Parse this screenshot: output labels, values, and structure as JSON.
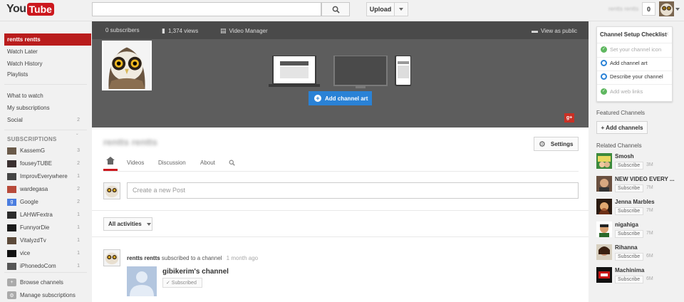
{
  "masthead": {
    "logo_you": "You",
    "logo_tube": "Tube",
    "upload_label": "Upload",
    "username": "rentts rentts",
    "notification_count": "0"
  },
  "guide": {
    "top_items": [
      {
        "label": "rentts rentts",
        "active": true
      },
      {
        "label": "Watch Later"
      },
      {
        "label": "Watch History"
      },
      {
        "label": "Playlists"
      }
    ],
    "mid_items": [
      {
        "label": "What to watch"
      },
      {
        "label": "My subscriptions"
      },
      {
        "label": "Social",
        "count": "2"
      }
    ],
    "subscriptions_heading": "SUBSCRIPTIONS",
    "subscriptions": [
      {
        "label": "KassemG",
        "count": "3"
      },
      {
        "label": "fouseyTUBE",
        "count": "2"
      },
      {
        "label": "ImprovEverywhere",
        "count": "1"
      },
      {
        "label": "wardegasa",
        "count": "2"
      },
      {
        "label": "Google",
        "count": "2"
      },
      {
        "label": "LAHWFextra",
        "count": "1"
      },
      {
        "label": "FunnyorDie",
        "count": "1"
      },
      {
        "label": "VitalyzdTv",
        "count": "1"
      },
      {
        "label": "vice",
        "count": "1"
      },
      {
        "label": "iPhonedoCom",
        "count": "1"
      }
    ],
    "browse_channels": "Browse channels",
    "manage_subscriptions": "Manage subscriptions"
  },
  "header": {
    "subscribers": "0 subscribers",
    "views": "1,374 views",
    "video_manager": "Video Manager",
    "view_as_public": "View as public",
    "add_channel_art": "Add channel art"
  },
  "channel": {
    "title": "rentts rentts",
    "settings_label": "Settings",
    "tabs": [
      "Videos",
      "Discussion",
      "About"
    ],
    "composer_placeholder": "Create a new Post",
    "activities_label": "All activities"
  },
  "feed": {
    "actor": "rentts rentts",
    "action": "subscribed to a channel",
    "ago": "1 month ago",
    "channel_name": "gibikerim's channel",
    "subscribed_label": "✓ Subscribed"
  },
  "right": {
    "checklist_title": "Channel Setup Checklist",
    "checklist": [
      {
        "label": "Set your channel icon",
        "done": true
      },
      {
        "label": "Add channel art",
        "done": false
      },
      {
        "label": "Describe your channel",
        "done": false
      },
      {
        "label": "Add web links",
        "done": true
      }
    ],
    "featured_heading": "Featured Channels",
    "add_channels_label": "+ Add channels",
    "related_heading": "Related Channels",
    "related": [
      {
        "name": "Smosh",
        "count": "3M"
      },
      {
        "name": "NEW VIDEO EVERY ...",
        "count": "7M"
      },
      {
        "name": "Jenna Marbles",
        "count": "7M"
      },
      {
        "name": "nigahiga",
        "count": "7M"
      },
      {
        "name": "Rihanna",
        "count": "6M"
      },
      {
        "name": "Machinima",
        "count": "6M"
      }
    ],
    "subscribe_label": "Subscribe"
  },
  "colors": {
    "brand_red": "#cc181e",
    "accent_blue": "#2a82d6",
    "check_green": "#5fb760",
    "header_gray": "#5d5d5d"
  }
}
